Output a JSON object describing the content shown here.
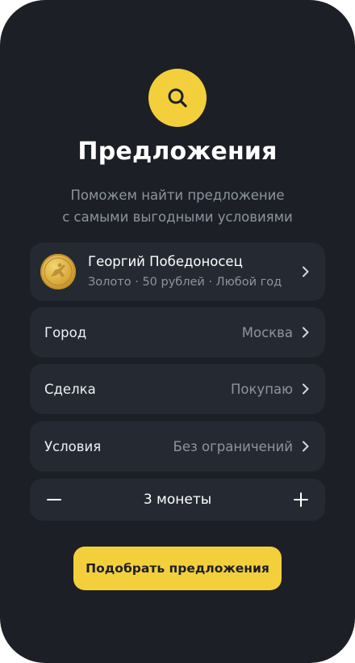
{
  "header": {
    "icon": "search-icon",
    "title": "Предложения",
    "subtitle_line1": "Поможем найти предложение",
    "subtitle_line2": "с самыми выгодными условиями"
  },
  "coin": {
    "name": "Георгий Победоносец",
    "details": "Золото · 50 рублей · Любой год"
  },
  "filters": {
    "city": {
      "label": "Город",
      "value": "Москва"
    },
    "deal": {
      "label": "Сделка",
      "value": "Покупаю"
    },
    "conditions": {
      "label": "Условия",
      "value": "Без ограничений"
    }
  },
  "quantity": {
    "value": "3 монеты"
  },
  "cta": {
    "label": "Подобрать предложения"
  },
  "colors": {
    "accent": "#f4cf3c",
    "background": "#1c2026",
    "card": "#252a32",
    "muted": "#8d949e"
  }
}
